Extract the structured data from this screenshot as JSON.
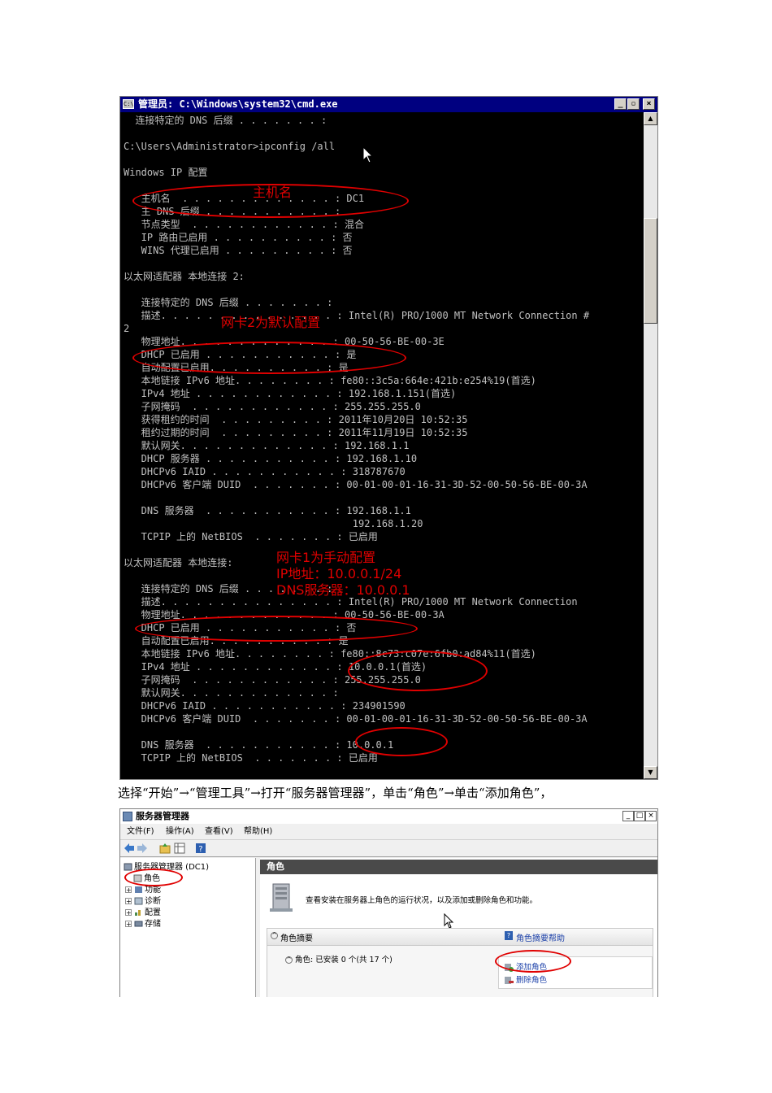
{
  "cmd": {
    "title": "管理员: C:\\Windows\\system32\\cmd.exe",
    "icon": "cmd-icon",
    "buttons": {
      "minimize": "_",
      "restore": "▫",
      "close": "×"
    },
    "lines": [
      "  连接特定的 DNS 后缀 . . . . . . . :",
      "",
      "C:\\Users\\Administrator>ipconfig /all",
      "",
      "Windows IP 配置",
      "",
      "   主机名  . . . . . . . . . . . . . : DC1",
      "   主 DNS 后缀 . . . . . . . . . . . :",
      "   节点类型  . . . . . . . . . . . . : 混合",
      "   IP 路由已启用 . . . . . . . . . . : 否",
      "   WINS 代理已启用 . . . . . . . . . : 否",
      "",
      "以太网适配器 本地连接 2:",
      "",
      "   连接特定的 DNS 后缀 . . . . . . . :",
      "   描述. . . . . . . . . . . . . . . : Intel(R) PRO/1000 MT Network Connection #",
      "2",
      "   物理地址. . . . . . . . . . . . . : 00-50-56-BE-00-3E",
      "   DHCP 已启用 . . . . . . . . . . . : 是",
      "   自动配置已启用. . . . . . . . . . : 是",
      "   本地链接 IPv6 地址. . . . . . . . : fe80::3c5a:664e:421b:e254%19(首选)",
      "   IPv4 地址 . . . . . . . . . . . . : 192.168.1.151(首选)",
      "   子网掩码  . . . . . . . . . . . . : 255.255.255.0",
      "   获得租约的时间  . . . . . . . . . : 2011年10月20日 10:52:35",
      "   租约过期的时间  . . . . . . . . . : 2011年11月19日 10:52:35",
      "   默认网关. . . . . . . . . . . . . : 192.168.1.1",
      "   DHCP 服务器 . . . . . . . . . . . : 192.168.1.10",
      "   DHCPv6 IAID . . . . . . . . . . . : 318787670",
      "   DHCPv6 客户端 DUID  . . . . . . . : 00-01-00-01-16-31-3D-52-00-50-56-BE-00-3A",
      "",
      "   DNS 服务器  . . . . . . . . . . . : 192.168.1.1",
      "                                       192.168.1.20",
      "   TCPIP 上的 NetBIOS  . . . . . . . : 已启用",
      "",
      "以太网适配器 本地连接:",
      "",
      "   连接特定的 DNS 后缀 . . . . . . . :",
      "   描述. . . . . . . . . . . . . . . : Intel(R) PRO/1000 MT Network Connection",
      "   物理地址. . . . . . . . . . . . . : 00-50-56-BE-00-3A",
      "   DHCP 已启用 . . . . . . . . . . . : 否",
      "   自动配置已启用. . . . . . . . . . : 是",
      "   本地链接 IPv6 地址. . . . . . . . : fe80::8c73:c07e:6fb0:ad84%11(首选)",
      "   IPv4 地址 . . . . . . . . . . . . : 10.0.0.1(首选)",
      "   子网掩码  . . . . . . . . . . . . : 255.255.255.0",
      "   默认网关. . . . . . . . . . . . . :",
      "   DHCPv6 IAID . . . . . . . . . . . : 234901590",
      "   DHCPv6 客户端 DUID  . . . . . . . : 00-01-00-01-16-31-3D-52-00-50-56-BE-00-3A",
      "",
      "   DNS 服务器  . . . . . . . . . . . : 10.0.0.1",
      "   TCPIP 上的 NetBIOS  . . . . . . . : 已启用"
    ],
    "annotations": {
      "hostname": "主机名",
      "nic2": "网卡2为默认配置",
      "nic1_line1": "网卡1为手动配置",
      "nic1_line2": "IP地址：10.0.0.1/24",
      "nic1_line3": "DNS服务器：10.0.0.1"
    },
    "annotation_color": "#e00000"
  },
  "caption": "选择“开始”→“管理工具”→打开“服务器管理器”，单击“角色”→单击“添加角色”，",
  "server_manager": {
    "title": "服务器管理器",
    "buttons": {
      "minimize": "_",
      "restore": "□",
      "close": "×"
    },
    "menu": [
      "文件(F)",
      "操作(A)",
      "查看(V)",
      "帮助(H)"
    ],
    "tree": {
      "root": "服务器管理器 (DC1)",
      "items": [
        "角色",
        "功能",
        "诊断",
        "配置",
        "存储"
      ]
    },
    "main": {
      "header": "角色",
      "description": "查看安装在服务器上角色的运行状况，以及添加或删除角色和功能。",
      "panel_title": "角色摘要",
      "panel_help": "角色摘要帮助",
      "roles_status": "角色: 已安装 0 个(共 17 个)",
      "add_roles": "添加角色",
      "remove_roles": "删除角色"
    }
  }
}
